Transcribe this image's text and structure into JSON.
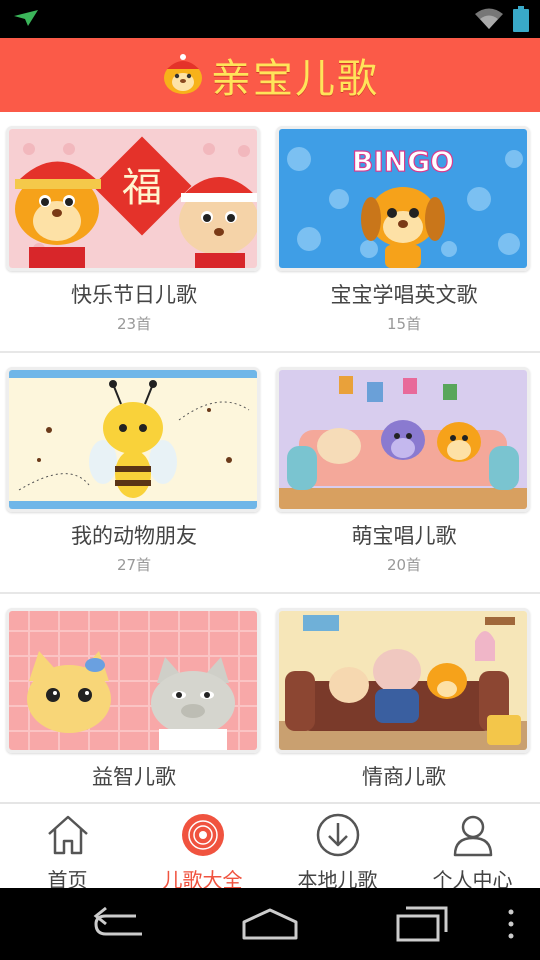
{
  "app": {
    "title": "亲宝儿歌"
  },
  "categories": [
    {
      "name": "快乐节日儿歌",
      "count": "23首",
      "art": "festival"
    },
    {
      "name": "宝宝学唱英文歌",
      "count": "15首",
      "art": "bingo",
      "art_text": "BINGO"
    },
    {
      "name": "我的动物朋友",
      "count": "27首",
      "art": "bee"
    },
    {
      "name": "萌宝唱儿歌",
      "count": "20首",
      "art": "sofa"
    },
    {
      "name": "益智儿歌",
      "count": "",
      "art": "cats"
    },
    {
      "name": "情商儿歌",
      "count": "",
      "art": "family"
    }
  ],
  "festival_char": "福",
  "tabs": [
    {
      "label": "首页",
      "icon": "home-icon",
      "active": false
    },
    {
      "label": "儿歌大全",
      "icon": "disc-icon",
      "active": true
    },
    {
      "label": "本地儿歌",
      "icon": "download-icon",
      "active": false
    },
    {
      "label": "个人中心",
      "icon": "person-icon",
      "active": false
    }
  ],
  "colors": {
    "accent": "#fb5a48",
    "title_text": "#ffe45a",
    "active_tab": "#f0533f"
  }
}
